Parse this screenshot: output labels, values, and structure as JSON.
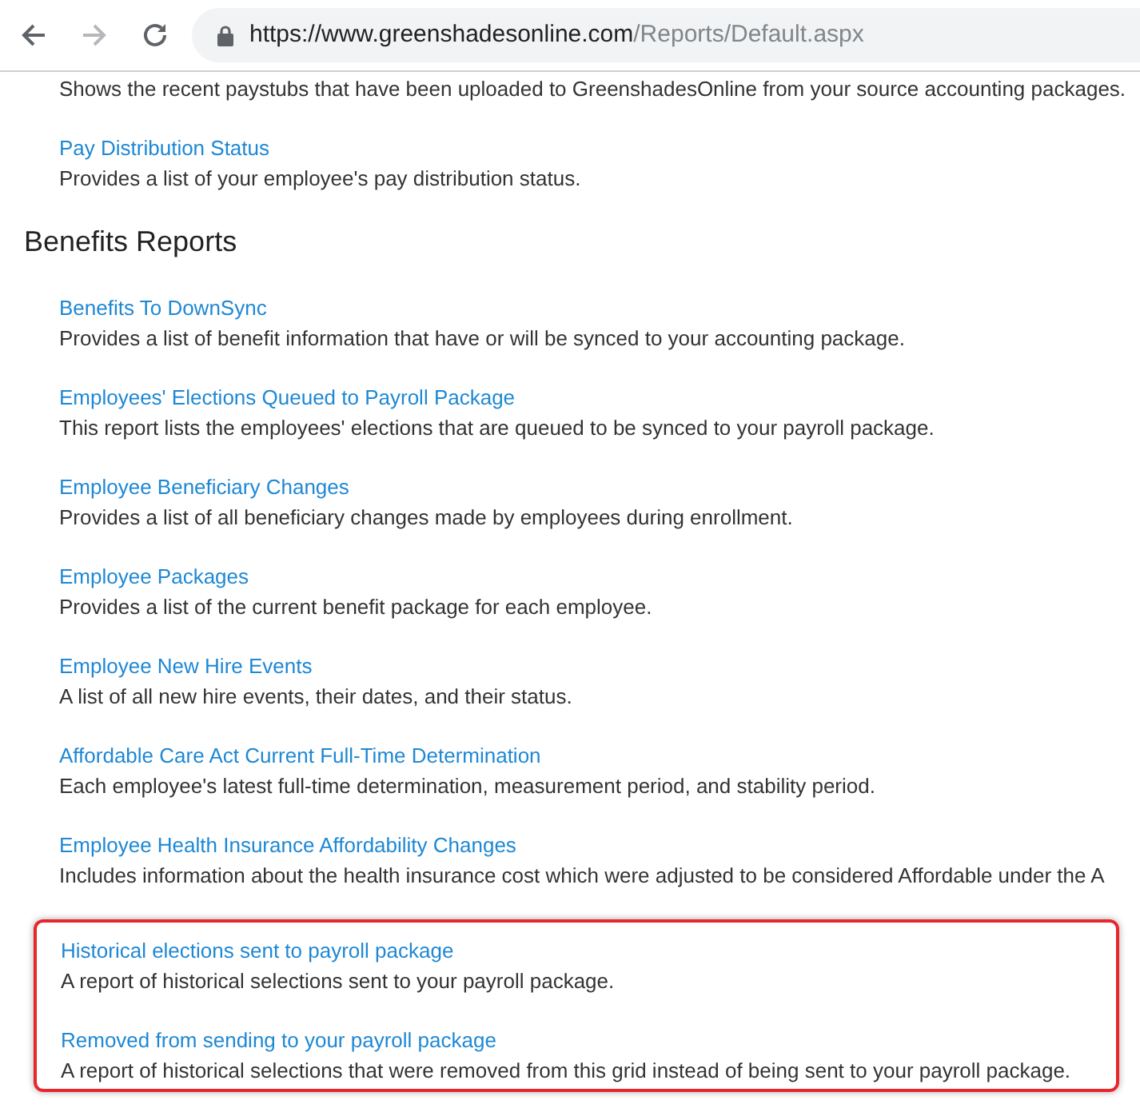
{
  "browser": {
    "url_origin": "https://www.greenshadesonline.com",
    "url_path": "/Reports/Default.aspx",
    "secure": true
  },
  "top_reports": [
    {
      "description": "Shows the recent paystubs that have been uploaded to GreenshadesOnline from your source accounting packages."
    },
    {
      "title": "Pay Distribution Status",
      "description": "Provides a list of your employee's pay distribution status."
    }
  ],
  "benefits_reports": {
    "heading": "Benefits Reports",
    "items": [
      {
        "title": "Benefits To DownSync",
        "description": "Provides a list of benefit information that have or will be synced to your accounting package.",
        "highlighted": false
      },
      {
        "title": "Employees' Elections Queued to Payroll Package",
        "description": "This report lists the employees' elections that are queued to be synced to your payroll package.",
        "highlighted": false
      },
      {
        "title": "Employee Beneficiary Changes",
        "description": "Provides a list of all beneficiary changes made by employees during enrollment.",
        "highlighted": false
      },
      {
        "title": "Employee Packages",
        "description": "Provides a list of the current benefit package for each employee.",
        "highlighted": false
      },
      {
        "title": "Employee New Hire Events",
        "description": "A list of all new hire events, their dates, and their status.",
        "highlighted": false
      },
      {
        "title": "Affordable Care Act Current Full-Time Determination",
        "description": "Each employee's latest full-time determination, measurement period, and stability period.",
        "highlighted": false
      },
      {
        "title": "Employee Health Insurance Affordability Changes",
        "description": "Includes information about the health insurance cost which were adjusted to be considered Affordable under the A",
        "highlighted": false
      },
      {
        "title": "Historical elections sent to payroll package",
        "description": "A report of historical selections sent to your payroll package.",
        "highlighted": true
      },
      {
        "title": "Removed from sending to your payroll package",
        "description": "A report of historical selections that were removed from this grid instead of being sent to your payroll package.",
        "highlighted": true
      }
    ]
  }
}
